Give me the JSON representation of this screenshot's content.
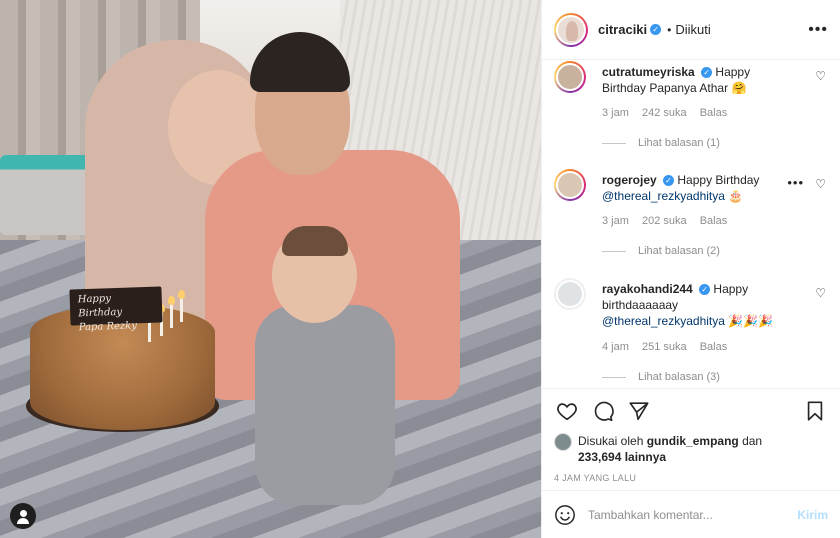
{
  "photo": {
    "cake_sign": [
      "Happy Birthday",
      "Papa Rezky"
    ],
    "user_tag_icon": "user-icon"
  },
  "post_header": {
    "username": "citraciki",
    "verified_icon": "verified-badge-icon",
    "separator": "•",
    "follow_label": "Diikuti",
    "more_icon": "more-options-icon"
  },
  "comments": [
    {
      "username": "cutratumeyriska",
      "text": "Happy Birthday Papanya Athar",
      "emoji": "🤗",
      "time": "3 jam",
      "likes": "242 suka",
      "reply_label": "Balas",
      "view_replies": "Lihat balasan (1)",
      "story_ring": true
    },
    {
      "username": "rogerojey",
      "text": "Happy Birthday",
      "mention": "@thereal_rezkyadhitya",
      "emoji": "🎂",
      "time": "3 jam",
      "likes": "202 suka",
      "reply_label": "Balas",
      "view_replies": "Lihat balasan (2)",
      "story_ring": true
    },
    {
      "username": "rayakohandi244",
      "text": "Happy birthdaaaaaay",
      "mention": "@thereal_rezkyadhitya",
      "emoji": "🎉🎉🎉",
      "time": "4 jam",
      "likes": "251 suka",
      "reply_label": "Balas",
      "view_replies": "Lihat balasan (3)",
      "story_ring": false
    }
  ],
  "actions": {
    "like_icon": "heart-icon",
    "comment_icon": "comment-icon",
    "share_icon": "share-icon",
    "save_icon": "bookmark-icon"
  },
  "likes": {
    "prefix": "Disukai oleh",
    "user": "gundik_empang",
    "connector": "dan",
    "count": "233,694 lainnya"
  },
  "timestamp": "4 JAM YANG LALU",
  "add_comment": {
    "placeholder": "Tambahkan komentar...",
    "send_label": "Kirim",
    "emoji_icon": "emoji-icon"
  },
  "colors": {
    "verified": "#3897f0",
    "mention": "#00376b",
    "send_disabled": "#b2dffc",
    "muted": "#8e8e8e"
  }
}
